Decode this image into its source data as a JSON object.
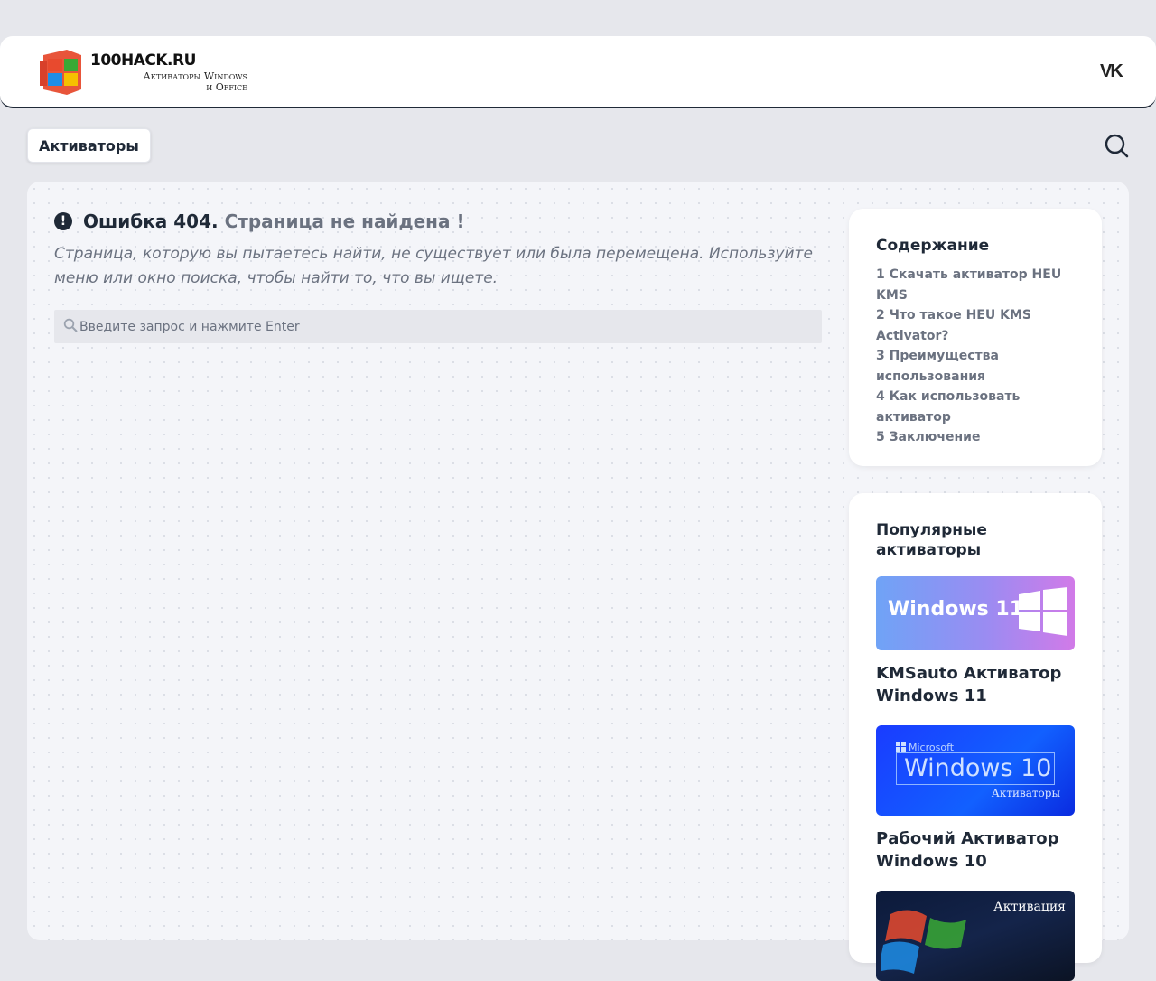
{
  "header": {
    "logo_title": "100HACK.RU",
    "logo_subtitle_line1": "Активаторы Windows",
    "logo_subtitle_line2": "и Office",
    "social_icon": "vk-icon",
    "social_label": "VK"
  },
  "nav": {
    "menu_label": "Активаторы",
    "search_icon": "search-icon"
  },
  "error": {
    "icon": "exclamation-circle-icon",
    "icon_glyph": "!",
    "title": "Ошибка 404.",
    "subtitle": "Страница не найдена !",
    "description": "Страница, которую вы пытаетесь найти, не существует или была перемещена. Используйте меню или окно поиска, чтобы найти то, что вы ищете."
  },
  "search": {
    "placeholder": "Введите запрос и нажмите Enter",
    "value": ""
  },
  "toc": {
    "title": "Содержание",
    "items": [
      "1 Скачать активатор HEU KMS",
      "2 Что такое HEU KMS Activator?",
      "3 Преимущества использования",
      "4 Как использовать активатор",
      "5 Заключение"
    ]
  },
  "popular": {
    "title": "Популярные активаторы",
    "items": [
      {
        "thumb_text": "Windows 11",
        "title": "KMSauto Активатор Windows 11"
      },
      {
        "thumb_brand": "Microsoft",
        "thumb_text": "Windows 10",
        "thumb_sub": "Активаторы",
        "title": "Рабочий Активатор Windows 10"
      },
      {
        "thumb_text": "Активация"
      }
    ]
  },
  "colors": {
    "background": "#e6e7ec",
    "text_primary": "#1f2937",
    "text_muted": "#6b7280",
    "card": "#ffffff"
  }
}
